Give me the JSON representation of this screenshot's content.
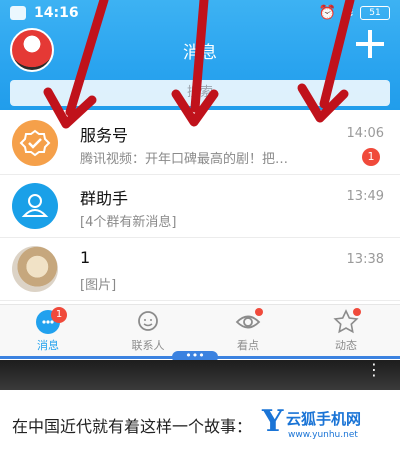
{
  "status": {
    "time": "14:16",
    "battery": "51"
  },
  "header": {
    "title": "消息",
    "search_placeholder": "搜索"
  },
  "messages": [
    {
      "name": "服务号",
      "preview": "腾讯视频：开年口碑最高的剧！把…",
      "time": "14:06",
      "badge": "1",
      "avatar": "service-icon"
    },
    {
      "name": "群助手",
      "preview": "[4个群有新消息]",
      "time": "13:49",
      "badge": "",
      "avatar": "group-assistant-icon"
    },
    {
      "name": "1",
      "preview": "[图片]",
      "time": "13:38",
      "badge": "",
      "avatar": "photo-avatar"
    }
  ],
  "tabs": [
    {
      "label": "消息",
      "badge": "1",
      "icon": "chat-bubble-icon",
      "active": true
    },
    {
      "label": "联系人",
      "icon": "contact-icon"
    },
    {
      "label": "看点",
      "icon": "eye-icon",
      "dot": true
    },
    {
      "label": "动态",
      "icon": "star-icon",
      "dot": true
    }
  ],
  "handle_text": "•••",
  "article": {
    "text": "在中国近代就有着这样一个故事："
  },
  "watermark": {
    "name": "云狐手机网",
    "url": "www.yunhu.net"
  },
  "colors": {
    "header": "#2aa4ef",
    "badge": "#f04a3b",
    "arrow": "#c0121b",
    "tab_active": "#21a1ee"
  }
}
